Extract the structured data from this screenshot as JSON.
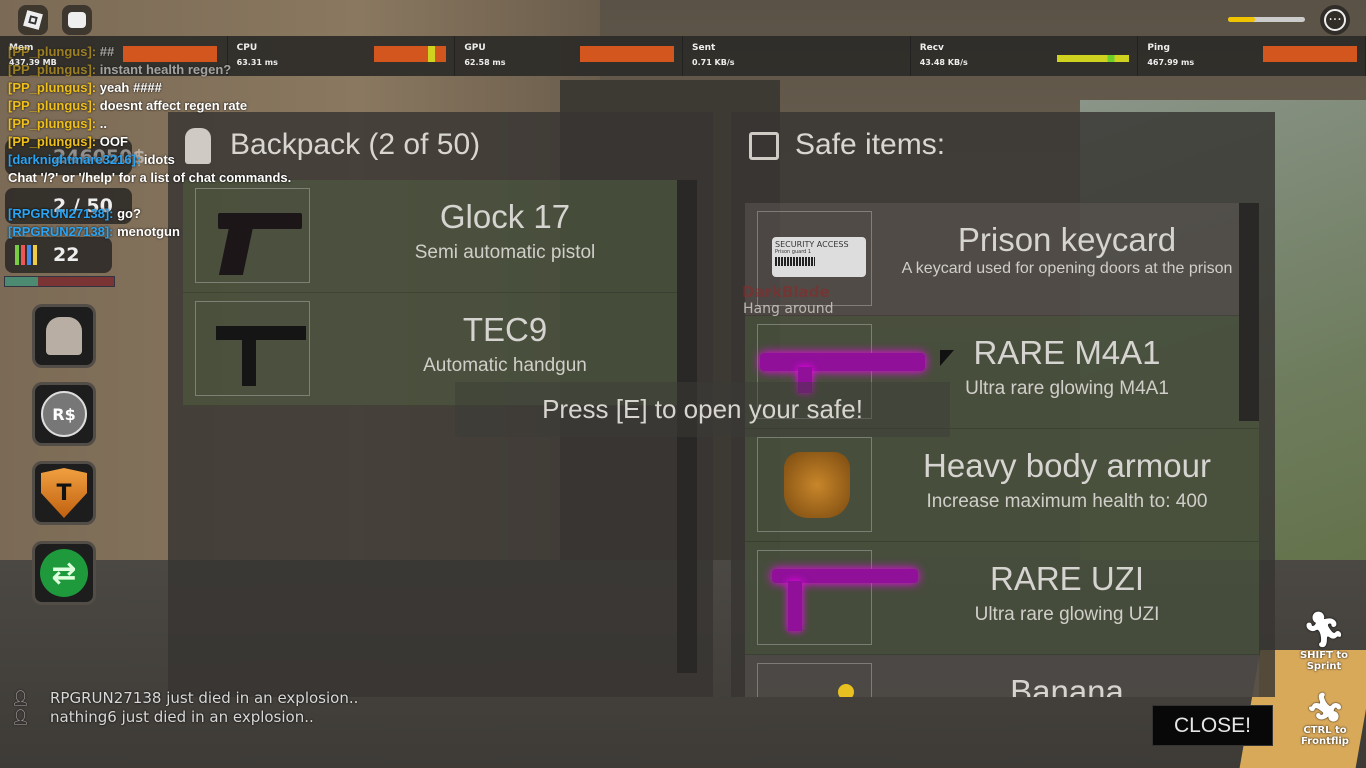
{
  "topbar": {
    "roblox_menu_icon": "roblox-logo-icon",
    "chat_icon": "chat-bubble-icon",
    "more_icon": "ellipsis-icon",
    "health_fraction": 0.35
  },
  "stats": [
    {
      "label": "Mem",
      "value": "437.39 MB"
    },
    {
      "label": "CPU",
      "value": "63.31 ms"
    },
    {
      "label": "GPU",
      "value": "62.58 ms"
    },
    {
      "label": "Sent",
      "value": "0.71 KB/s"
    },
    {
      "label": "Recv",
      "value": "43.48 KB/s"
    },
    {
      "label": "Ping",
      "value": "467.99 ms"
    }
  ],
  "colors": {
    "stat_bad": "#d4561f",
    "stat_warn": "#cfd21e",
    "stat_good": "#6fcf2a",
    "chat_user_yellow": "#f0c01a",
    "chat_user_blue": "#2aa4f4"
  },
  "chat": [
    {
      "user": "[PP_plungus]:",
      "msg": "##",
      "color": "y"
    },
    {
      "user": "[PP_plungus]:",
      "msg": "instant health regen?",
      "color": "y"
    },
    {
      "user": "[PP_plungus]:",
      "msg": "yeah ####",
      "color": "y"
    },
    {
      "user": "[PP_plungus]:",
      "msg": "doesnt affect regen rate",
      "color": "y"
    },
    {
      "user": "[PP_plungus]:",
      "msg": "..",
      "color": "y"
    },
    {
      "user": "[PP_plungus]:",
      "msg": "OOF",
      "color": "y"
    },
    {
      "user": "[darknightmare3216]:",
      "msg": "idots",
      "color": "b"
    },
    {
      "user": "",
      "msg": "Chat '/?' or '/help' for a list of chat commands.",
      "color": "w"
    },
    {
      "user": "[RPGRUN27138]:",
      "msg": "go?",
      "color": "b"
    },
    {
      "user": "[RPGRUN27138]:",
      "msg": "menotgun",
      "color": "b"
    }
  ],
  "hud": {
    "money": "246050$",
    "backpack_count": "2 / 50",
    "level": "22",
    "health_fraction": 0.3,
    "buttons": [
      {
        "name": "backpack-button",
        "icon": "backpack-icon"
      },
      {
        "name": "robux-shop-button",
        "icon": "robux-icon"
      },
      {
        "name": "team-button",
        "icon": "shield-t-icon"
      },
      {
        "name": "refresh-button",
        "icon": "refresh-icon"
      }
    ]
  },
  "backpack": {
    "title": "Backpack (2 of 50)",
    "icon": "backpack-icon",
    "items": [
      {
        "name": "Glock 17",
        "desc": "Semi automatic pistol",
        "icon": "pistol-icon"
      },
      {
        "name": "TEC9",
        "desc": "Automatic handgun",
        "icon": "tec9-icon"
      }
    ]
  },
  "safe": {
    "title": "Safe items:",
    "icon": "archive-box-icon",
    "items": [
      {
        "name": "Prison keycard",
        "desc": "A keycard used for opening doors at the prison",
        "icon": "keycard-icon",
        "card_text": "SECURITY ACCESS",
        "card_sub": "Prison guard 1"
      },
      {
        "name": "RARE M4A1",
        "desc": "Ultra rare glowing M4A1",
        "icon": "rifle-icon"
      },
      {
        "name": "Heavy body armour",
        "desc": "Increase maximum health to: 400",
        "icon": "body-armour-icon"
      },
      {
        "name": "RARE UZI",
        "desc": "Ultra rare glowing UZI",
        "icon": "uzi-icon"
      },
      {
        "name": "Banana",
        "desc": "",
        "icon": "banana-icon"
      }
    ]
  },
  "prompt": "Press [E] to open your safe!",
  "npc": {
    "name": "DarkBlade",
    "status": "Hang around"
  },
  "close_label": "CLOSE!",
  "killfeed": [
    "RPGRUN27138 just died in an explosion..",
    "nathing6 just died in an explosion.."
  ],
  "controls": {
    "sprint": "SHIFT to Sprint",
    "frontflip": "CTRL to Frontflip"
  }
}
